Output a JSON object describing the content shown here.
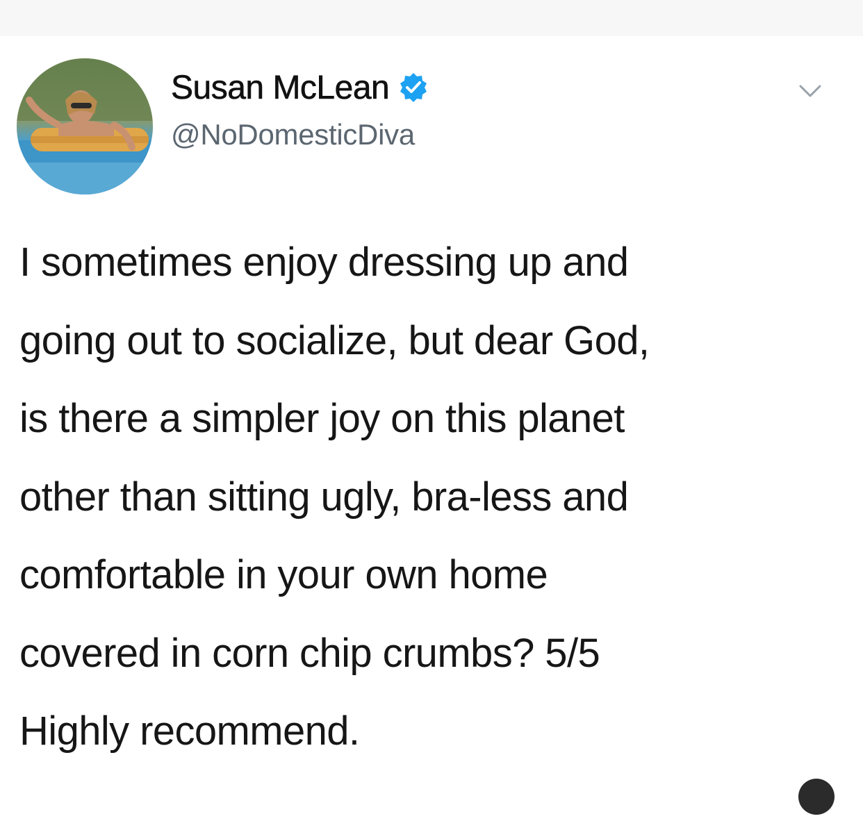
{
  "tweet": {
    "display_name": "Susan McLean",
    "handle": "@NoDomesticDiva",
    "verified": true,
    "text": "I sometimes enjoy dressing up and\ngoing out to socialize, but dear God,\nis there a simpler joy on this planet\nother than sitting ugly, bra-less and\ncomfortable in your own home\ncovered in corn chip crumbs? 5/5\nHighly recommend."
  },
  "icons": {
    "verified": "verified-badge-icon",
    "more": "chevron-down-icon"
  },
  "colors": {
    "verified_blue": "#1da1f2",
    "handle_gray": "#5b6670",
    "text": "#161616"
  }
}
